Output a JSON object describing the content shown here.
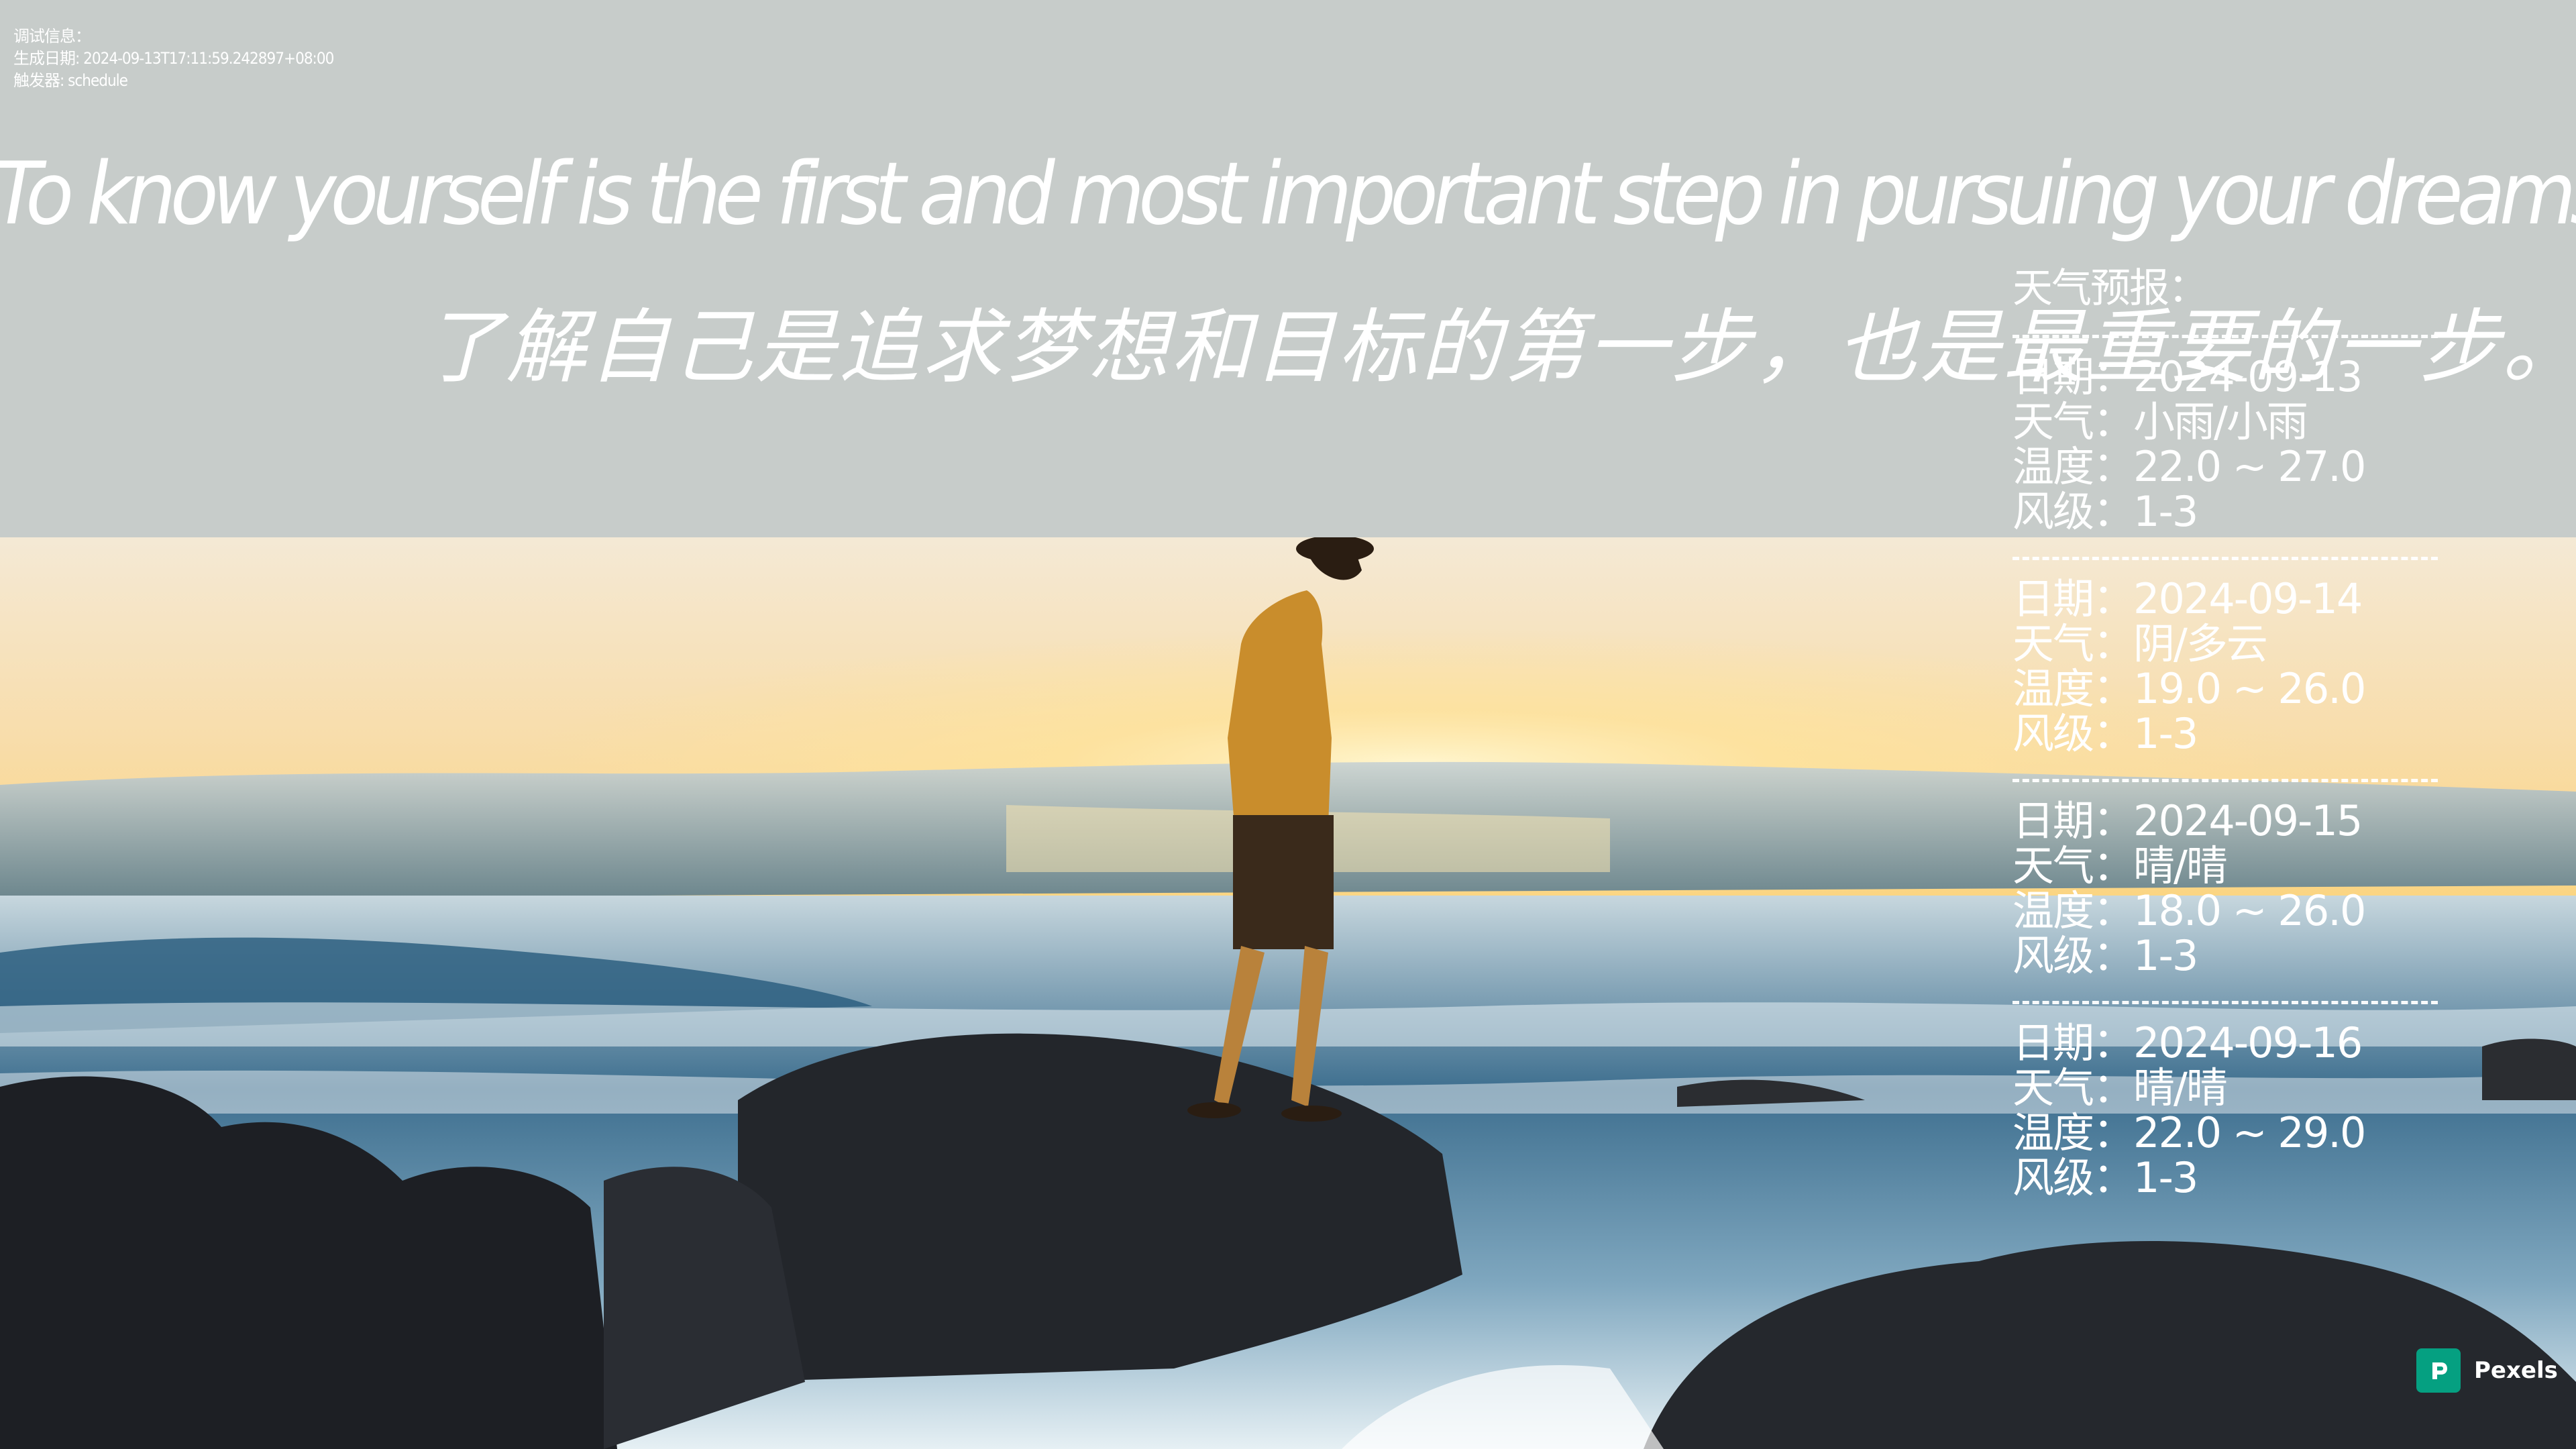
{
  "debug": {
    "title": "调试信息：",
    "generated": "生成日期: 2024-09-13T17:11:59.242897+08:00",
    "trigger": "触发器: schedule"
  },
  "quote": {
    "en": "To know yourself is the first and most important step in pursuing your dreams and goals.",
    "zh": "了解自己是追求梦想和目标的第一步，也是最重要的一步。"
  },
  "weather": {
    "title": "天气预报：",
    "days": [
      {
        "date": "日期：2024-09-13",
        "weather": "天气：小雨/小雨",
        "temp": "温度：22.0 ~ 27.0",
        "wind": "风级：1-3"
      },
      {
        "date": "日期：2024-09-14",
        "weather": "天气：阴/多云",
        "temp": "温度：19.0 ~ 26.0",
        "wind": "风级：1-3"
      },
      {
        "date": "日期：2024-09-15",
        "weather": "天气：晴/晴",
        "temp": "温度：18.0 ~ 26.0",
        "wind": "风级：1-3"
      },
      {
        "date": "日期：2024-09-16",
        "weather": "天气：晴/晴",
        "temp": "温度：22.0 ~ 29.0",
        "wind": "风级：1-3"
      }
    ]
  },
  "credit": {
    "brand": "Pexels",
    "icon": "pexels-logo-icon",
    "color": "#05a081"
  }
}
